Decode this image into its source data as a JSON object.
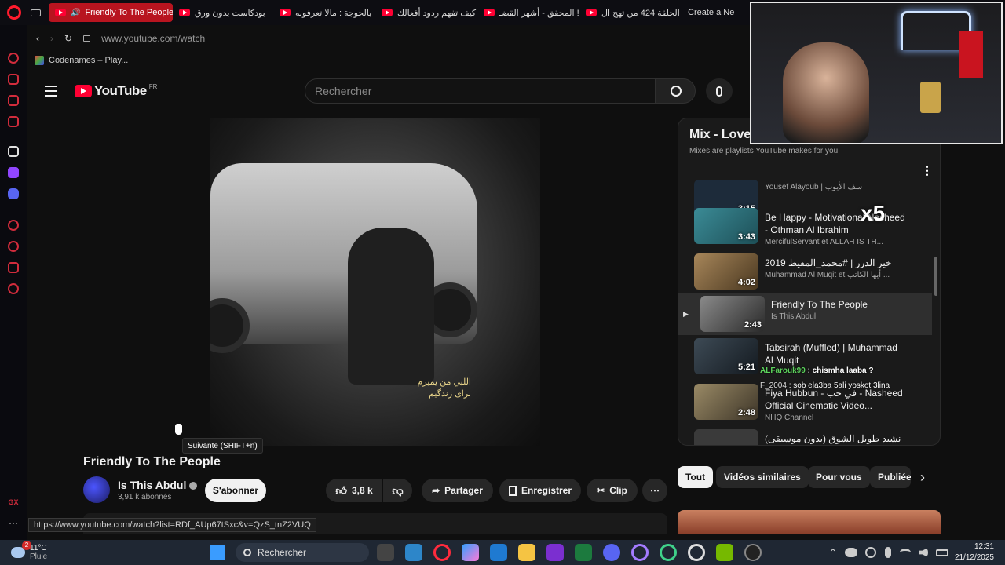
{
  "browser": {
    "tabs": [
      {
        "label": "Friendly To The People",
        "active": true
      },
      {
        "label": "بودكاست بدون ورق"
      },
      {
        "label": "بالحوجة : مالا تعرفونه"
      },
      {
        "label": "كيف تفهم ردود أفعالك"
      },
      {
        "label": "المحقق - أشهر القضـ !"
      },
      {
        "label": "الحلقة 424 من تهج ال"
      },
      {
        "label": "Create a Ne"
      }
    ],
    "url": "www.youtube.com/watch",
    "bookmark": "Codenames – Play...",
    "status_url": "https://www.youtube.com/watch?list=RDf_AUp67tSxc&v=QzS_tnZ2VUQ"
  },
  "youtube": {
    "logo": "YouTube",
    "region": "FR",
    "search_placeholder": "Rechercher"
  },
  "video": {
    "overlay_line1": "اللبي من يميرم",
    "overlay_line2": "براى زندگيم",
    "tooltip": "Suivante (SHIFT+n)",
    "title": "Friendly To The People",
    "channel": "Is This Abdul",
    "subscribers": "3,91 k abonnés",
    "subscribe_label": "S'abonner",
    "likes": "3,8 k",
    "share_label": "Partager",
    "save_label": "Enregistrer",
    "clip_label": "Clip"
  },
  "playlist": {
    "title": "Mix - Love",
    "subtitle": "Mixes are playlists YouTube makes for you",
    "items": [
      {
        "title": "",
        "author": "Yousef Alayoub | سف الأيوب",
        "duration": "3:15",
        "thumb": "#1d2b3a"
      },
      {
        "title": "Be Happy - Motivational Nasheed - Othman Al Ibrahim",
        "author": "MercifulServant et ALLAH IS TH...",
        "duration": "3:43",
        "thumb": "#2e6f7a"
      },
      {
        "title": "2019 خير الدرر | #محمد_المقيط",
        "author": "Muhammad Al Muqit et أيها الكاتب ...",
        "duration": "4:02",
        "thumb": "#8a6a3d"
      },
      {
        "title": "Friendly To The People",
        "author": "Is This Abdul",
        "duration": "2:43",
        "thumb": "#6d6d6d",
        "current": true
      },
      {
        "title": "Tabsirah (Muffled) | Muhammad Al Muqit",
        "author": "",
        "duration": "5:21",
        "thumb": "#2a3540"
      },
      {
        "title": "Fiya Hubbun - في حب - Nasheed Official Cinematic Video...",
        "author": "NHQ Channel",
        "duration": "2:48",
        "thumb": "#7a6a4a"
      },
      {
        "title": "نشيد طويل الشوق (بدون موسيقى)",
        "author": "",
        "duration": "",
        "thumb": "#3a3a3a"
      }
    ]
  },
  "chat": [
    {
      "user": "ALFarouk99",
      "msg": ": chismha laaba ?"
    },
    {
      "user": "F_2004",
      "msg": ": sob ela3ba 5ali yoskot 3lina"
    }
  ],
  "chips": [
    "Tout",
    "Vidéos similaires",
    "Pour vous",
    "Publiée"
  ],
  "overlay_badge": "x5",
  "taskbar": {
    "weather_temp": "11°C",
    "weather_desc": "Pluie",
    "search_label": "Rechercher",
    "time": "12:31",
    "date": "21/12/2025",
    "badge_count": "2"
  },
  "sidebar_footer": "GX",
  "colors": {
    "accent": "#ff0033",
    "bg": "#0f0f0f",
    "chip_active": "#f1f1f1"
  }
}
